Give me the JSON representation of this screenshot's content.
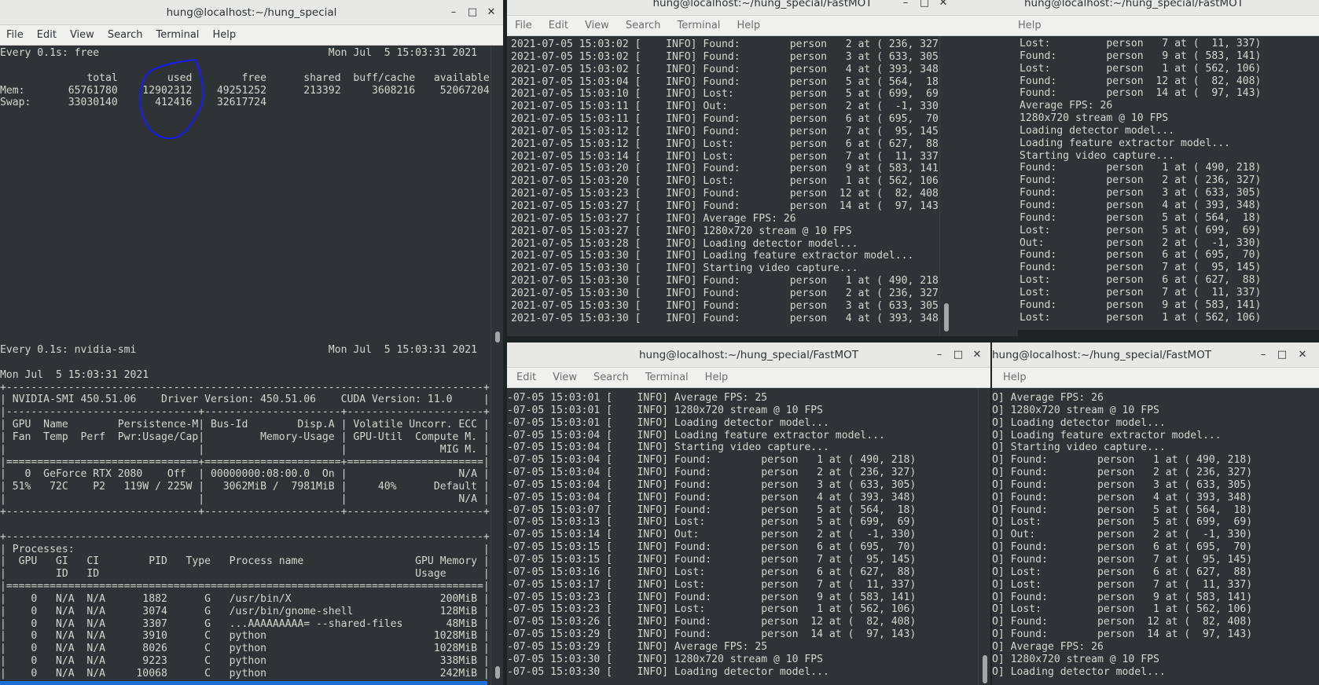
{
  "windows": {
    "free": {
      "title": "hung@localhost:~/hung_special",
      "menu": [
        "File",
        "Edit",
        "View",
        "Search",
        "Terminal",
        "Help"
      ],
      "lines": [
        "Every 0.1s: free                                     Mon Jul  5 15:03:31 2021",
        "",
        "              total        used        free      shared  buff/cache   available",
        "Mem:       65761780    12902312    49251252      213392     3608216    52067204",
        "Swap:      33030140      412416    32617724"
      ]
    },
    "smi": {
      "lines": [
        "Every 0.1s: nvidia-smi                               Mon Jul  5 15:03:31 2021",
        "",
        "Mon Jul  5 15:03:31 2021",
        "+-----------------------------------------------------------------------------+",
        "| NVIDIA-SMI 450.51.06    Driver Version: 450.51.06    CUDA Version: 11.0     |",
        "|-------------------------------+----------------------+----------------------+",
        "| GPU  Name        Persistence-M| Bus-Id        Disp.A | Volatile Uncorr. ECC |",
        "| Fan  Temp  Perf  Pwr:Usage/Cap|         Memory-Usage | GPU-Util  Compute M. |",
        "|                               |                      |               MIG M. |",
        "|===============================+======================+======================|",
        "|   0  GeForce RTX 2080    Off  | 00000000:08:00.0  On |                  N/A |",
        "| 51%   72C    P2   119W / 225W |   3062MiB /  7981MiB |     40%      Default |",
        "|                               |                      |                  N/A |",
        "+-------------------------------+----------------------+----------------------+",
        "",
        "+-----------------------------------------------------------------------------+",
        "| Processes:                                                                  |",
        "|  GPU   GI   CI        PID   Type   Process name                  GPU Memory |",
        "|        ID   ID                                                   Usage      |",
        "|=============================================================================|",
        "|    0   N/A  N/A      1882      G   /usr/bin/X                        200MiB |",
        "|    0   N/A  N/A      3074      G   /usr/bin/gnome-shell              128MiB |",
        "|    0   N/A  N/A      3307      G   ...AAAAAAAAA= --shared-files       48MiB |",
        "|    0   N/A  N/A      3910      C   python                           1028MiB |",
        "|    0   N/A  N/A      8026      C   python                           1028MiB |",
        "|    0   N/A  N/A      9223      C   python                            338MiB |",
        "|    0   N/A  N/A     10068      C   python                            242MiB |"
      ]
    },
    "topmid": {
      "title": "hung@localhost:~/hung_special/FastMOT",
      "menu": [
        "File",
        "Edit",
        "View",
        "Search",
        "Terminal",
        "Help"
      ],
      "lines": [
        "2021-07-05 15:03:02 [    INFO] Found:        person   2 at ( 236, 327)",
        "2021-07-05 15:03:02 [    INFO] Found:        person   3 at ( 633, 305)",
        "2021-07-05 15:03:02 [    INFO] Found:        person   4 at ( 393, 348)",
        "2021-07-05 15:03:04 [    INFO] Found:        person   5 at ( 564,  18)",
        "2021-07-05 15:03:10 [    INFO] Lost:         person   5 at ( 699,  69)",
        "2021-07-05 15:03:11 [    INFO] Out:          person   2 at (  -1, 330)",
        "2021-07-05 15:03:11 [    INFO] Found:        person   6 at ( 695,  70)",
        "2021-07-05 15:03:12 [    INFO] Found:        person   7 at (  95, 145)",
        "2021-07-05 15:03:12 [    INFO] Lost:         person   6 at ( 627,  88)",
        "2021-07-05 15:03:14 [    INFO] Lost:         person   7 at (  11, 337)",
        "2021-07-05 15:03:20 [    INFO] Found:        person   9 at ( 583, 141)",
        "2021-07-05 15:03:20 [    INFO] Lost:         person   1 at ( 562, 106)",
        "2021-07-05 15:03:23 [    INFO] Found:        person  12 at (  82, 408)",
        "2021-07-05 15:03:27 [    INFO] Found:        person  14 at (  97, 143)",
        "2021-07-05 15:03:27 [    INFO] Average FPS: 26",
        "2021-07-05 15:03:27 [    INFO] 1280x720 stream @ 10 FPS",
        "2021-07-05 15:03:28 [    INFO] Loading detector model...",
        "2021-07-05 15:03:30 [    INFO] Loading feature extractor model...",
        "2021-07-05 15:03:30 [    INFO] Starting video capture...",
        "2021-07-05 15:03:30 [    INFO] Found:        person   1 at ( 490, 218)",
        "2021-07-05 15:03:30 [    INFO] Found:        person   2 at ( 236, 327)",
        "2021-07-05 15:03:30 [    INFO] Found:        person   3 at ( 633, 305)",
        "2021-07-05 15:03:30 [    INFO] Found:        person   4 at ( 393, 348)"
      ]
    },
    "topright": {
      "title": "hung@localhost:~/hung_special/FastMOT",
      "menu": [
        "Help"
      ],
      "lines": [
        "Lost:         person   7 at (  11, 337)",
        "Found:        person   9 at ( 583, 141)",
        "Lost:         person   1 at ( 562, 106)",
        "Found:        person  12 at (  82, 408)",
        "Found:        person  14 at (  97, 143)",
        "Average FPS: 26",
        "1280x720 stream @ 10 FPS",
        "Loading detector model...",
        "Loading feature extractor model...",
        "Starting video capture...",
        "Found:        person   1 at ( 490, 218)",
        "Found:        person   2 at ( 236, 327)",
        "Found:        person   3 at ( 633, 305)",
        "Found:        person   4 at ( 393, 348)",
        "Found:        person   5 at ( 564,  18)",
        "Lost:         person   5 at ( 699,  69)",
        "Out:          person   2 at (  -1, 330)",
        "Found:        person   6 at ( 695,  70)",
        "Found:        person   7 at (  95, 145)",
        "Lost:         person   6 at ( 627,  88)",
        "Lost:         person   7 at (  11, 337)",
        "Found:        person   9 at ( 583, 141)",
        "Lost:         person   1 at ( 562, 106)"
      ]
    },
    "botmid": {
      "title": "hung@localhost:~/hung_special/FastMOT",
      "menu": [
        "Edit",
        "View",
        "Search",
        "Terminal",
        "Help"
      ],
      "lines": [
        "-07-05 15:03:01 [    INFO] Average FPS: 25",
        "-07-05 15:03:01 [    INFO] 1280x720 stream @ 10 FPS",
        "-07-05 15:03:01 [    INFO] Loading detector model...",
        "-07-05 15:03:04 [    INFO] Loading feature extractor model...",
        "-07-05 15:03:04 [    INFO] Starting video capture...",
        "-07-05 15:03:04 [    INFO] Found:        person   1 at ( 490, 218)",
        "-07-05 15:03:04 [    INFO] Found:        person   2 at ( 236, 327)",
        "-07-05 15:03:04 [    INFO] Found:        person   3 at ( 633, 305)",
        "-07-05 15:03:04 [    INFO] Found:        person   4 at ( 393, 348)",
        "-07-05 15:03:07 [    INFO] Found:        person   5 at ( 564,  18)",
        "-07-05 15:03:13 [    INFO] Lost:         person   5 at ( 699,  69)",
        "-07-05 15:03:14 [    INFO] Out:          person   2 at (  -1, 330)",
        "-07-05 15:03:15 [    INFO] Found:        person   6 at ( 695,  70)",
        "-07-05 15:03:15 [    INFO] Found:        person   7 at (  95, 145)",
        "-07-05 15:03:16 [    INFO] Lost:         person   6 at ( 627,  88)",
        "-07-05 15:03:17 [    INFO] Lost:         person   7 at (  11, 337)",
        "-07-05 15:03:23 [    INFO] Found:        person   9 at ( 583, 141)",
        "-07-05 15:03:23 [    INFO] Lost:         person   1 at ( 562, 106)",
        "-07-05 15:03:26 [    INFO] Found:        person  12 at (  82, 408)",
        "-07-05 15:03:29 [    INFO] Found:        person  14 at (  97, 143)",
        "-07-05 15:03:29 [    INFO] Average FPS: 25",
        "-07-05 15:03:30 [    INFO] 1280x720 stream @ 10 FPS",
        "-07-05 15:03:30 [    INFO] Loading detector model..."
      ]
    },
    "botright": {
      "title": "hung@localhost:~/hung_special/FastMOT",
      "menu": [
        "Help"
      ],
      "lines": [
        "O] Average FPS: 26",
        "O] 1280x720 stream @ 10 FPS",
        "O] Loading detector model...",
        "O] Loading feature extractor model...",
        "O] Starting video capture...",
        "O] Found:        person   1 at ( 490, 218)",
        "O] Found:        person   2 at ( 236, 327)",
        "O] Found:        person   3 at ( 633, 305)",
        "O] Found:        person   4 at ( 393, 348)",
        "O] Found:        person   5 at ( 564,  18)",
        "O] Lost:         person   5 at ( 699,  69)",
        "O] Out:          person   2 at (  -1, 330)",
        "O] Found:        person   6 at ( 695,  70)",
        "O] Found:        person   7 at (  95, 145)",
        "O] Lost:         person   6 at ( 627,  88)",
        "O] Lost:         person   7 at (  11, 337)",
        "O] Found:        person   9 at ( 583, 141)",
        "O] Lost:         person   1 at ( 562, 106)",
        "O] Found:        person  12 at (  82, 408)",
        "O] Found:        person  14 at (  97, 143)",
        "O] Average FPS: 26",
        "O] 1280x720 stream @ 10 FPS",
        "O] Loading detector model..."
      ]
    }
  },
  "controls": {
    "minimize": "–",
    "maximize": "□",
    "close": "✕"
  },
  "colors": {
    "terminal_bg": "#2e3436",
    "terminal_fg": "#d3d7cf",
    "annotation": "#1a1aff",
    "taskbar": "#1c71d8"
  }
}
